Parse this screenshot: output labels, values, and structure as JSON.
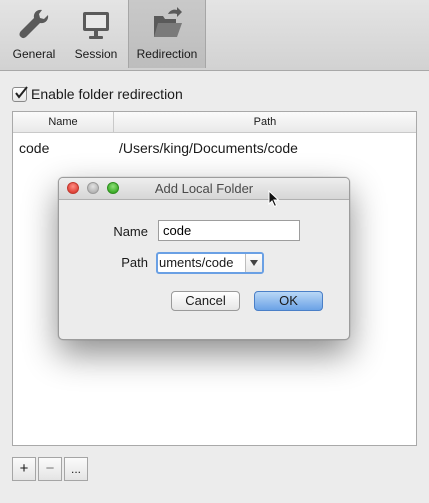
{
  "toolbar": {
    "items": [
      {
        "label": "General",
        "icon": "wrench-icon"
      },
      {
        "label": "Session",
        "icon": "monitor-icon"
      },
      {
        "label": "Redirection",
        "icon": "folder-open-icon",
        "selected": true
      }
    ]
  },
  "redirection": {
    "enable_label": "Enable folder redirection",
    "enabled": true,
    "columns": [
      "Name",
      "Path"
    ],
    "rows": [
      {
        "name": "code",
        "path": "/Users/king/Documents/code"
      }
    ],
    "buttons": {
      "add": "+",
      "remove": "−",
      "more": "..."
    }
  },
  "dialog": {
    "title": "Add Local Folder",
    "name_label": "Name",
    "name_value": "code",
    "path_label": "Path",
    "path_value": "uments/code",
    "cancel_label": "Cancel",
    "ok_label": "OK"
  },
  "colors": {
    "accent": "#6aa0e4",
    "default_button": "#6ba2e6",
    "close_light": "#e0443a",
    "zoom_light": "#3fae2a"
  }
}
